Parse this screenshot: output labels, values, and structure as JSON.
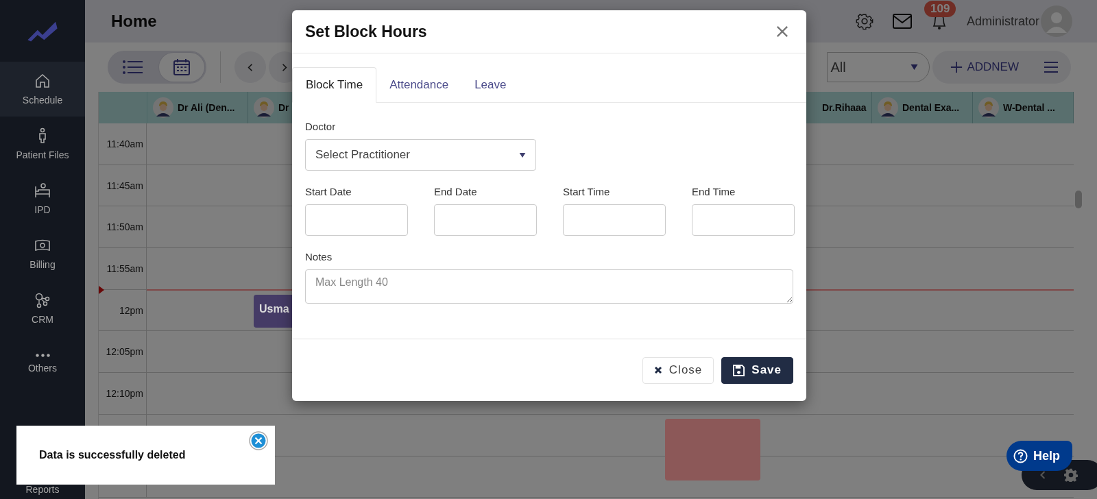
{
  "sidebar": {
    "items": [
      {
        "kind": "home",
        "label": "Schedule",
        "selected": true
      },
      {
        "kind": "person",
        "label": "Patient Files",
        "selected": false
      },
      {
        "kind": "bed",
        "label": "IPD",
        "selected": false
      },
      {
        "kind": "money",
        "label": "Billing",
        "selected": false
      },
      {
        "kind": "network",
        "label": "CRM",
        "selected": false
      },
      {
        "kind": "more",
        "label": "Others",
        "selected": false
      },
      {
        "kind": "none",
        "label": "Reports",
        "selected": false
      }
    ]
  },
  "header": {
    "title": "Home",
    "notification_count": "109",
    "user": "Administrator"
  },
  "toolbar": {
    "views": [
      {
        "kind": "list",
        "selected": false
      },
      {
        "kind": "calendar",
        "selected": true
      }
    ],
    "filter": {
      "value": "All"
    },
    "add_button": "ADDNEW"
  },
  "calendar": {
    "columns_left": [
      {
        "name": "Dr Ali (Den..."
      },
      {
        "name": "Dr"
      }
    ],
    "columns_right": [
      {
        "name": "Dr.Rihaaa"
      },
      {
        "name": "Dental Exa..."
      },
      {
        "name": "W-Dental ..."
      }
    ],
    "times": [
      "11:40am",
      "11:45am",
      "11:50am",
      "11:55am",
      "12pm",
      "12:05pm",
      "12:10pm"
    ],
    "events": [
      {
        "label": "Usma",
        "color": "#453b66"
      },
      {
        "color": "#8c5858"
      }
    ]
  },
  "modal": {
    "title": "Set Block Hours",
    "tabs": [
      {
        "label": "Block Time",
        "selected": true
      },
      {
        "label": "Attendance",
        "selected": false
      },
      {
        "label": "Leave",
        "selected": false
      }
    ],
    "fields": [
      {
        "kind": "select",
        "label": "Doctor",
        "value": "Select Practitioner"
      },
      {
        "kind": "input",
        "label": "Start Date"
      },
      {
        "kind": "input",
        "label": "End Date"
      },
      {
        "kind": "input",
        "label": "Start Time"
      },
      {
        "kind": "input",
        "label": "End Time"
      },
      {
        "kind": "textarea",
        "label": "Notes",
        "placeholder": "Max Length 40"
      }
    ],
    "buttons": [
      {
        "kind": "close",
        "label": "Close"
      },
      {
        "kind": "save",
        "label": "Save"
      }
    ]
  },
  "toast": {
    "message": "Data is successfully deleted"
  },
  "help": {
    "label": "Help"
  }
}
